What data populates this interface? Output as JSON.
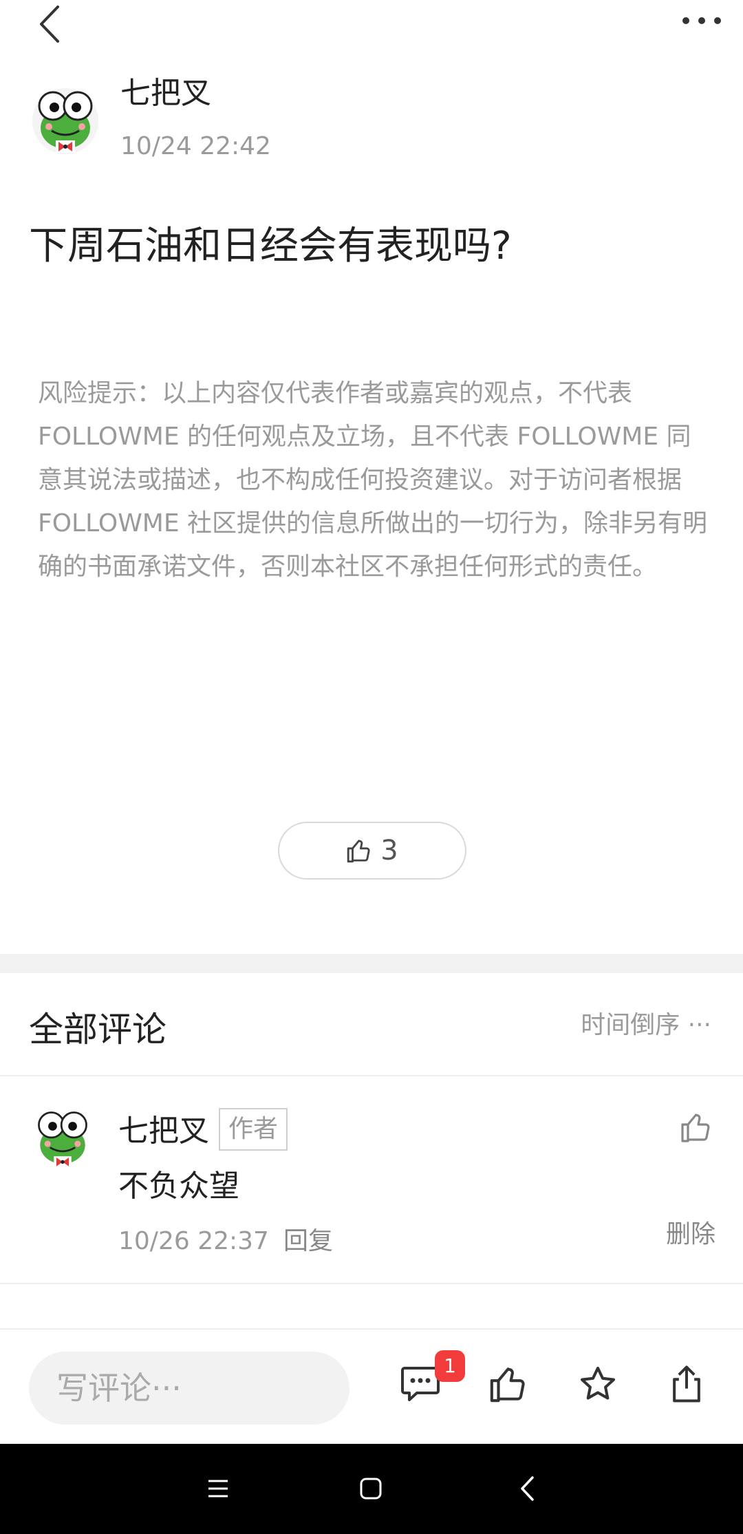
{
  "post": {
    "author_name": "七把叉",
    "time": "10/24 22:42",
    "title": "下周石油和日经会有表现吗?",
    "disclaimer": "风险提示：以上内容仅代表作者或嘉宾的观点，不代表 FOLLOWME 的任何观点及立场，且不代表 FOLLOWME 同意其说法或描述，也不构成任何投资建议。对于访问者根据 FOLLOWME 社区提供的信息所做出的一切行为，除非另有明确的书面承诺文件，否则本社区不承担任何形式的责任。",
    "like_count": "3"
  },
  "comments_section": {
    "title": "全部评论",
    "sort_label": "时间倒序",
    "comments": [
      {
        "author": "七把叉",
        "badge": "作者",
        "text": "不负众望",
        "time": "10/26 22:37",
        "reply_label": "回复",
        "delete_label": "删除"
      }
    ]
  },
  "bottom_bar": {
    "input_placeholder": "写评论···",
    "comment_badge": "1"
  },
  "icons": {
    "back": "back-chevron-icon",
    "more": "more-dots-icon",
    "like": "thumbs-up-icon",
    "comment": "comment-bubble-icon",
    "star": "star-icon",
    "share": "share-icon",
    "menu": "menu-icon",
    "home": "home-square-icon",
    "nav_back": "nav-back-icon"
  },
  "colors": {
    "accent_badge": "#f23b3b",
    "muted_text": "#9a9a9a",
    "nav_bg": "#000000"
  }
}
